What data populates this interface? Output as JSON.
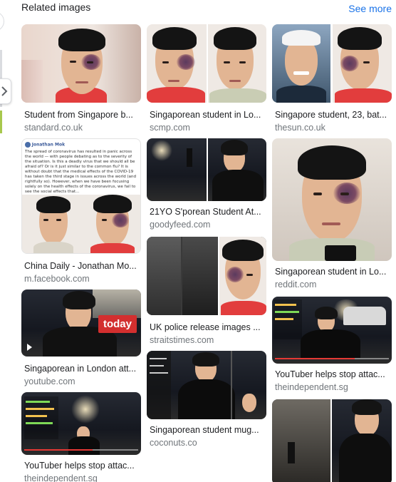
{
  "header": {
    "title": "Related images",
    "see_more": "See more"
  },
  "columns": [
    [
      {
        "caption": "Student from Singapore b...",
        "source": "standard.co.uk"
      },
      {
        "caption": "China Daily - Jonathan Mo...",
        "source": "m.facebook.com",
        "post_author": "Jonathan Mok",
        "post_text": "The spread of coronavirus has resulted in panic across the world — with people debating as to the severity of the situation. Is this a deadly virus that we should all be afraid of? Or is it just similar to the common flu? It is without doubt that the medical effects of the COVID-19 has taken the third stage in issues across the world (and rightfully so). However, when we have been focusing solely on the health effects of the coronavirus, we fail to see the social effects that..."
      },
      {
        "caption": "Singaporean in London att...",
        "source": "youtube.com",
        "badge": "today"
      },
      {
        "caption": "YouTuber helps stop attac...",
        "source": "theindependent.sg"
      }
    ],
    [
      {
        "caption": "Singaporean student in Lo...",
        "source": "scmp.com"
      },
      {
        "caption": "21YO S'porean Student At...",
        "source": "goodyfeed.com"
      },
      {
        "caption": "UK police release images ...",
        "source": "straitstimes.com"
      },
      {
        "caption": "Singaporean student mug...",
        "source": "coconuts.co"
      }
    ],
    [
      {
        "caption": "Singapore student, 23, bat...",
        "source": "thesun.co.uk"
      },
      {
        "caption": "Singaporean student in Lo...",
        "source": "reddit.com"
      },
      {
        "caption": "YouTuber helps stop attac...",
        "source": "theindependent.sg"
      },
      {
        "caption": "",
        "source": ""
      }
    ]
  ],
  "colors": {
    "link": "#1a73e8",
    "caption": "#202124",
    "source": "#70757a",
    "badge": "#d32f2f"
  },
  "icons": {
    "carousel_arrow": "chevron-right-icon"
  }
}
